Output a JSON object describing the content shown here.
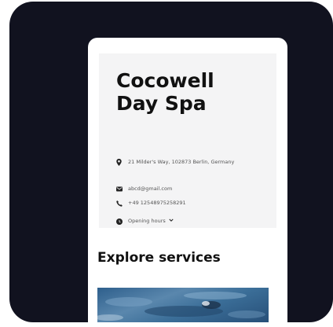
{
  "business": {
    "name": "Cocowell\nDay Spa",
    "address": "21 Milder's Way, 102873 Berlin, Germany",
    "email": "abcd@gmail.com",
    "phone": "+49 12548975258291",
    "hours_label": "Opening hours"
  },
  "services": {
    "heading": "Explore services"
  },
  "icons": {
    "address": "location-pin-icon",
    "email": "envelope-icon",
    "phone": "phone-icon",
    "hours": "clock-icon",
    "hours_toggle": "chevron-down-icon"
  },
  "colors": {
    "frame_background": "#11121f",
    "card_background": "#f4f4f5",
    "text_primary": "#111111",
    "text_secondary": "#555555"
  }
}
